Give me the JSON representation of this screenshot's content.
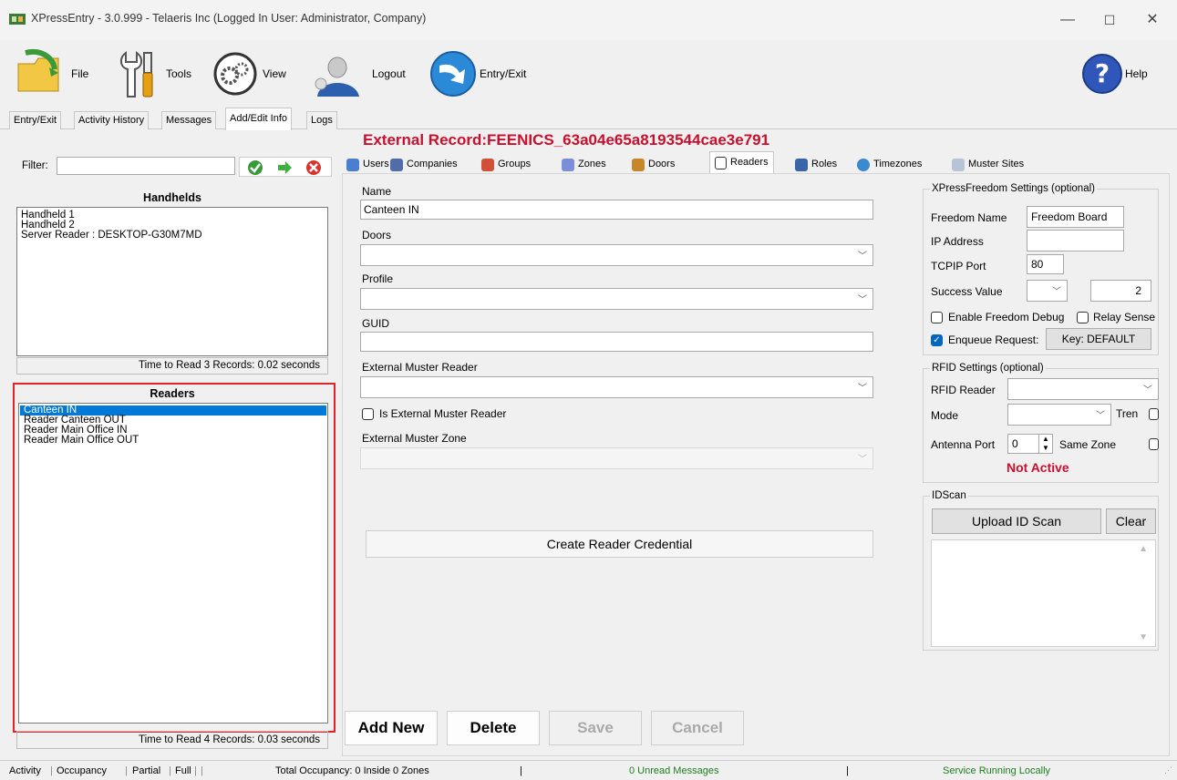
{
  "window": {
    "title": "XPressEntry - 3.0.999 - Telaeris Inc (Logged In User: Administrator, Company)",
    "minimize": "—",
    "maximize": "☐",
    "close": "✕"
  },
  "toolbar": {
    "file": "File",
    "tools": "Tools",
    "view": "View",
    "logout": "Logout",
    "entry_exit": "Entry/Exit",
    "help": "Help"
  },
  "main_tabs": [
    "Entry/Exit",
    "Activity History",
    "Messages",
    "Add/Edit Info",
    "Logs"
  ],
  "record_title": "External Record:FEENICS_63a04e65a8193544cae3e791",
  "filter": {
    "label": "Filter:",
    "value": ""
  },
  "handhelds": {
    "title": "Handhelds",
    "items": [
      "Handheld 1",
      "Handheld 2",
      "Server Reader : DESKTOP-G30M7MD"
    ],
    "footer": "Time to Read 3 Records: 0.02 seconds"
  },
  "readers": {
    "title": "Readers",
    "items": [
      "Canteen IN",
      "Reader Canteen OUT",
      "Reader Main Office IN",
      "Reader Main Office OUT"
    ],
    "selected_index": 0,
    "footer": "Time to Read 4 Records: 0.03 seconds"
  },
  "sub_tabs": [
    "Users",
    "Companies",
    "Groups",
    "Zones",
    "Doors",
    "Readers",
    "Roles",
    "Timezones",
    "Muster Sites"
  ],
  "form": {
    "name_label": "Name",
    "name_value": "Canteen IN",
    "doors_label": "Doors",
    "doors_value": "",
    "profile_label": "Profile",
    "profile_value": "",
    "guid_label": "GUID",
    "guid_value": "",
    "ext_muster_reader_label": "External Muster Reader",
    "ext_muster_reader_value": "",
    "is_ext_muster_reader_label": "Is External Muster Reader",
    "ext_muster_zone_label": "External Muster Zone",
    "ext_muster_zone_value": "",
    "create_credential": "Create Reader Credential"
  },
  "freedom": {
    "title": "XPressFreedom Settings (optional)",
    "name_label": "Freedom Name",
    "name_value": "Freedom Board",
    "ip_label": "IP Address",
    "ip_value": "",
    "port_label": "TCPIP Port",
    "port_value": "80",
    "success_label": "Success Value",
    "success_value": "",
    "success_num": "2",
    "debug_label": "Enable Freedom Debug",
    "relay_label": "Relay Sense",
    "enqueue_label": "Enqueue Request:",
    "key_button": "Key: DEFAULT"
  },
  "rfid": {
    "title": "RFID Settings (optional)",
    "reader_label": "RFID Reader",
    "reader_value": "",
    "mode_label": "Mode",
    "mode_value": "",
    "tren_label": "Tren",
    "antenna_label": "Antenna Port",
    "antenna_value": "0",
    "same_zone_label": "Same Zone",
    "status": "Not Active"
  },
  "idscan": {
    "title": "IDScan",
    "upload": "Upload ID Scan",
    "clear": "Clear"
  },
  "actions": {
    "add_new": "Add New",
    "delete": "Delete",
    "save": "Save",
    "cancel": "Cancel"
  },
  "status_bar": {
    "activity": "Activity",
    "occupancy": "Occupancy",
    "partial": "Partial",
    "full": "Full",
    "total": "Total Occupancy: 0 Inside 0 Zones",
    "messages": "0 Unread Messages",
    "service": "Service Running Locally"
  },
  "colors": {
    "accent": "#0078d7",
    "title_red": "#c8102e",
    "green_text": "#1a7f1a",
    "highlight_border": "#e0242a"
  }
}
